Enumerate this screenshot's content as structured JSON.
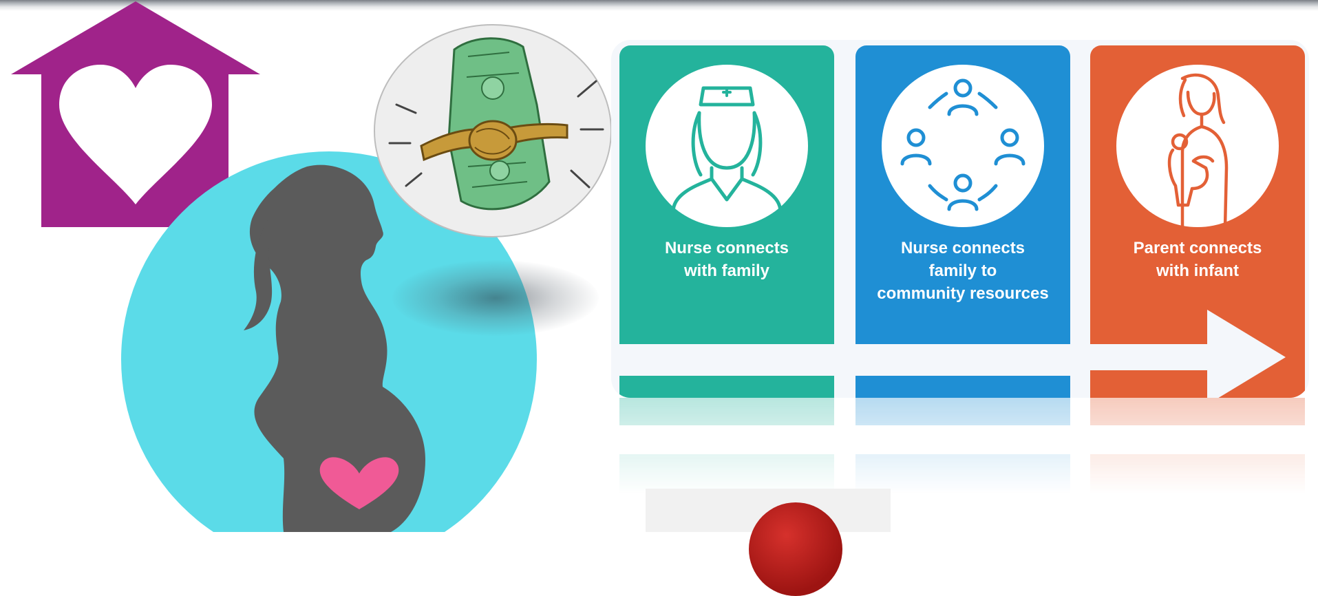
{
  "icons": {
    "house": "house-heart-icon",
    "pregnancy": "pregnant-woman-silhouette-icon",
    "money": "tied-money-icon",
    "nurse": "nurse-icon",
    "community": "community-circle-icon",
    "parent": "parent-holding-infant-icon",
    "arrow": "right-arrow-icon",
    "stop": "red-circle-icon"
  },
  "panels": [
    {
      "lines": [
        "Nurse connects",
        "with family"
      ],
      "color": "#24b39c"
    },
    {
      "lines": [
        "Nurse connects",
        "family to",
        "community resources"
      ],
      "color": "#1f8fd4"
    },
    {
      "lines": [
        "Parent connects",
        "with infant"
      ],
      "color": "#e36036"
    }
  ],
  "colors": {
    "house": "#a0238a",
    "circle": "#5bdbe8",
    "silhouette": "#5b5b5b",
    "heart": "#f05a96",
    "money_green": "#6fbf86",
    "rope": "#c79a3a"
  }
}
